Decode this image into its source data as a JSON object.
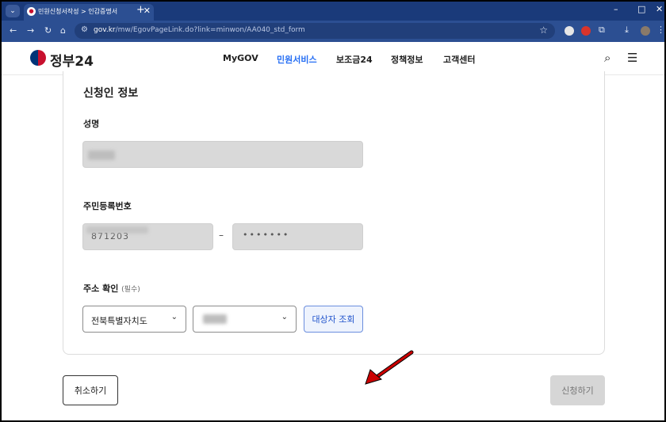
{
  "browser": {
    "tab_title": "민원신청서작성 > 인감증명서",
    "tab_close": "✕",
    "new_tab": "+",
    "url_host": "gov.kr",
    "url_path": "/mw/EgovPageLink.do?link=minwon/AA040_std_form",
    "window": {
      "minimize": "–",
      "maximize": "□",
      "close": "✕"
    }
  },
  "site": {
    "logo_text": "정부24",
    "nav": [
      "MyGOV",
      "민원서비스",
      "보조금24",
      "정책정보",
      "고객센터"
    ],
    "active_nav": "민원서비스"
  },
  "form": {
    "section_title": "신청인 정보",
    "name_label": "성명",
    "rrn_label": "주민등록번호",
    "rrn_front": "871203",
    "rrn_back": "•••••••",
    "rrn_separator": "–",
    "address_label": "주소 확인",
    "address_required": "(필수)",
    "address_province": "전북특별자치도",
    "address_city": "",
    "lookup_button": "대상자 조회"
  },
  "actions": {
    "cancel_button": "취소하기",
    "submit_button": "신청하기"
  },
  "colors": {
    "accent": "#256ef4",
    "browser_chrome": "#2c4f92",
    "arrow": "#cc0000"
  }
}
